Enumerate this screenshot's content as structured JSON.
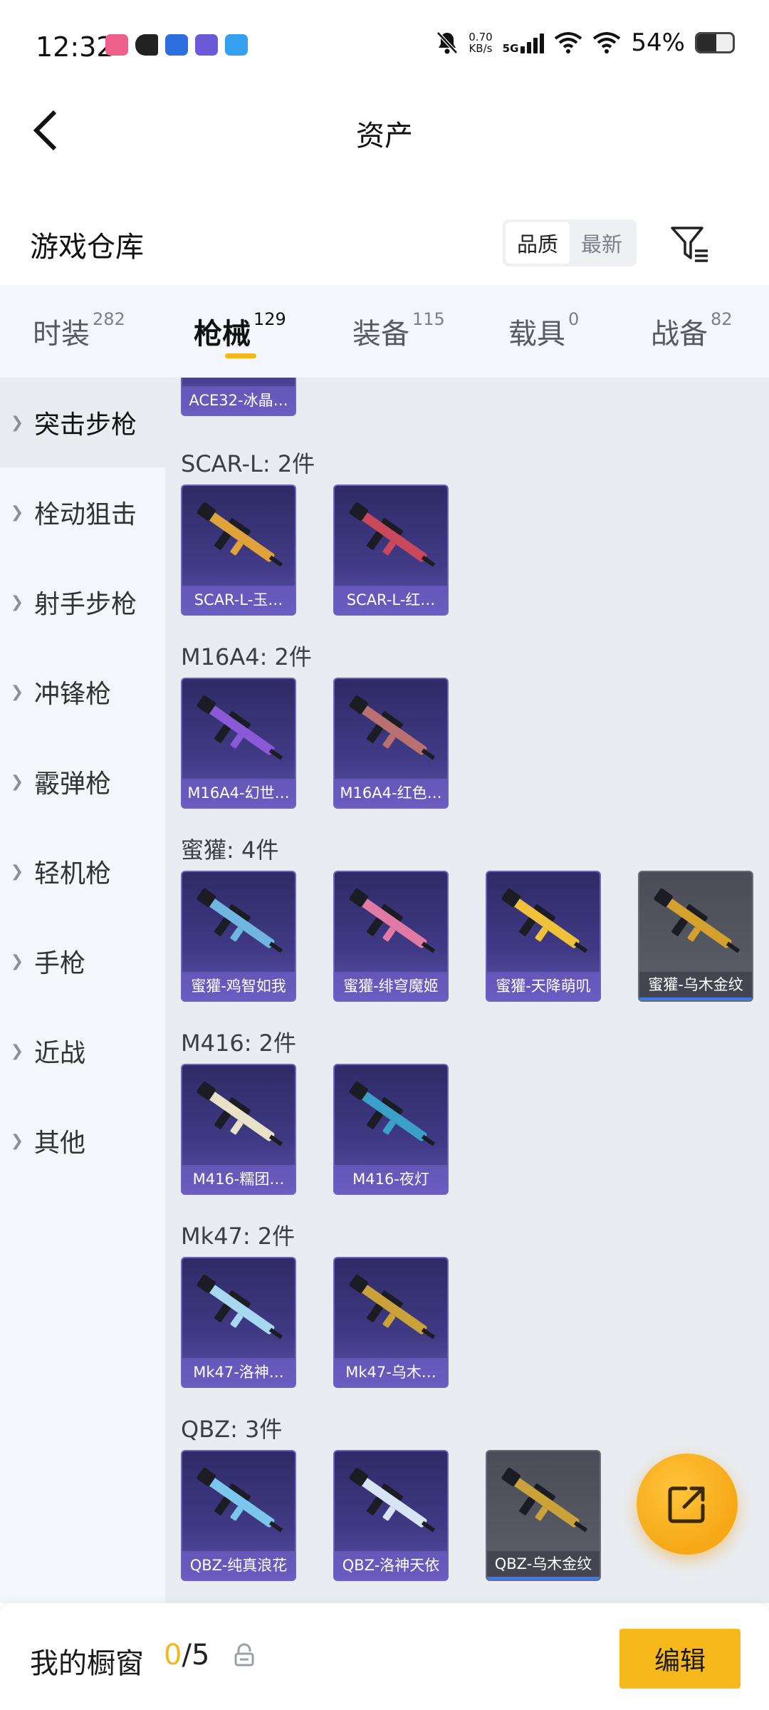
{
  "status_bar": {
    "time": "12:32",
    "net_speed_value": "0.70",
    "net_speed_unit": "KB/s",
    "network_type": "5G",
    "battery_percent": "54%",
    "battery_level": 0.54
  },
  "header": {
    "title": "资产",
    "back_icon": "chevron-left-icon"
  },
  "warehouse": {
    "title": "游戏仓库",
    "sort_options": [
      "品质",
      "最新"
    ],
    "sort_selected": "品质",
    "filter_icon": "filter-icon"
  },
  "tabs": [
    {
      "label": "时装",
      "count": "282"
    },
    {
      "label": "枪械",
      "count": "129"
    },
    {
      "label": "装备",
      "count": "115"
    },
    {
      "label": "载具",
      "count": "0"
    },
    {
      "label": "战备",
      "count": "82"
    }
  ],
  "active_tab": "枪械",
  "sidebar": {
    "items": [
      "突击步枪",
      "栓动狙击",
      "射手步枪",
      "冲锋枪",
      "霰弹枪",
      "轻机枪",
      "手枪",
      "近战",
      "其他"
    ],
    "active": "突击步枪"
  },
  "content": {
    "partial_top_card": "ACE32-冰晶…",
    "groups": [
      {
        "title": "SCAR-L: 2件",
        "items": [
          {
            "name": "SCAR-L-玉…",
            "grey": false,
            "accent": "#e0a33a"
          },
          {
            "name": "SCAR-L-红…",
            "grey": false,
            "accent": "#c9485b"
          }
        ]
      },
      {
        "title": "M16A4: 2件",
        "items": [
          {
            "name": "M16A4-幻世…",
            "grey": false,
            "accent": "#8a5ad6"
          },
          {
            "name": "M16A4-红色…",
            "grey": false,
            "accent": "#b87070"
          }
        ]
      },
      {
        "title": "蜜獾: 4件",
        "items": [
          {
            "name": "蜜獾-鸡智如我",
            "grey": false,
            "accent": "#6fb7e0"
          },
          {
            "name": "蜜獾-绯穹魔姬",
            "grey": false,
            "accent": "#e27aa6"
          },
          {
            "name": "蜜獾-天降萌叽",
            "grey": false,
            "accent": "#f0c23a"
          },
          {
            "name": "蜜獾-乌木金纹",
            "grey": true,
            "accent": "#d4a22c"
          }
        ]
      },
      {
        "title": "M416: 2件",
        "items": [
          {
            "name": "M416-糯团…",
            "grey": false,
            "accent": "#e8e2c8"
          },
          {
            "name": "M416-夜灯",
            "grey": false,
            "accent": "#3aa0c8"
          }
        ]
      },
      {
        "title": "Mk47: 2件",
        "items": [
          {
            "name": "Mk47-洛神…",
            "grey": false,
            "accent": "#a8d8f0"
          },
          {
            "name": "Mk47-乌木…",
            "grey": false,
            "accent": "#c9a23a"
          }
        ]
      },
      {
        "title": "QBZ: 3件",
        "items": [
          {
            "name": "QBZ-纯真浪花",
            "grey": false,
            "accent": "#7ac6ec"
          },
          {
            "name": "QBZ-洛神天依",
            "grey": false,
            "accent": "#d8e4f4"
          },
          {
            "name": "QBZ-乌木金纹",
            "grey": true,
            "accent": "#c9a23a"
          }
        ]
      }
    ]
  },
  "fab_icon": "share-icon",
  "bottom": {
    "label": "我的橱窗",
    "current": "0",
    "separator": "/",
    "total": "5",
    "lock_icon": "lock-icon",
    "edit_label": "编辑"
  }
}
